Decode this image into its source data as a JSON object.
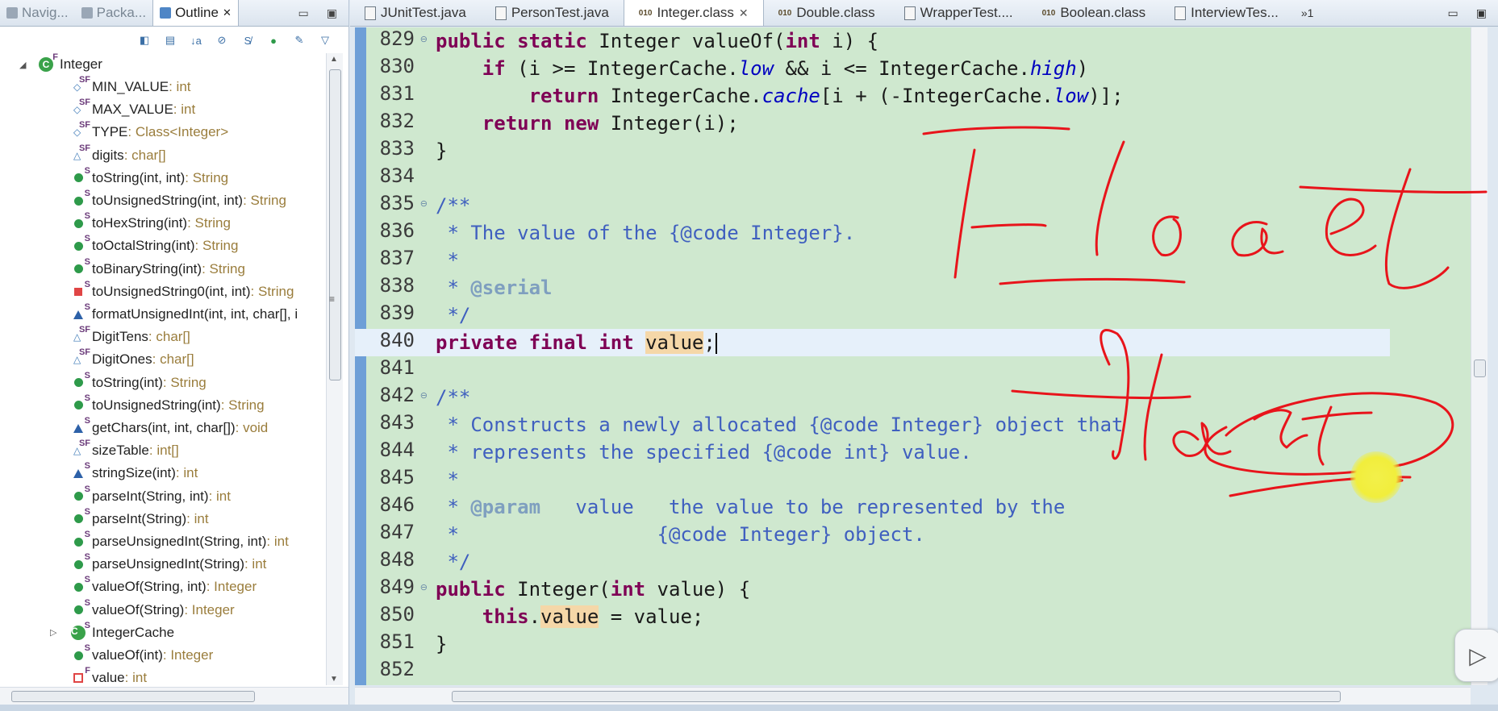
{
  "left_tabs": [
    {
      "label": "Navig...",
      "icon": "navigator-icon"
    },
    {
      "label": "Packa...",
      "icon": "package-icon"
    },
    {
      "label": "Outline",
      "icon": "outline-icon",
      "close": "✕"
    }
  ],
  "window_controls": {
    "minimize": "▭",
    "maximize": "▣"
  },
  "outline_tools": [
    "hide-fields-icon",
    "hide-static-icon",
    "sort-icon",
    "hide-nonpublic-icon",
    "hide-static-members-icon",
    "hide-local-icon",
    "focus-icon",
    "view-menu-icon"
  ],
  "tree_root": {
    "name": "Integer",
    "badge": "F",
    "twisty": "◢"
  },
  "tree_items": [
    {
      "label": "MIN_VALUE",
      "type": " : int",
      "kind": "field-const",
      "mod": "SF"
    },
    {
      "label": "MAX_VALUE",
      "type": " : int",
      "kind": "field-const",
      "mod": "SF"
    },
    {
      "label": "TYPE",
      "type": " : Class<Integer>",
      "kind": "field-const",
      "mod": "SF"
    },
    {
      "label": "digits",
      "type": " : char[]",
      "kind": "field-pkg",
      "mod": "SF"
    },
    {
      "label": "toString(int, int)",
      "type": " : String",
      "kind": "public",
      "mod": "S"
    },
    {
      "label": "toUnsignedString(int, int)",
      "type": " : String",
      "kind": "public",
      "mod": "S"
    },
    {
      "label": "toHexString(int)",
      "type": " : String",
      "kind": "public",
      "mod": "S"
    },
    {
      "label": "toOctalString(int)",
      "type": " : String",
      "kind": "public",
      "mod": "S"
    },
    {
      "label": "toBinaryString(int)",
      "type": " : String",
      "kind": "public",
      "mod": "S"
    },
    {
      "label": "toUnsignedString0(int, int)",
      "type": " : String",
      "kind": "private",
      "mod": "S"
    },
    {
      "label": "formatUnsignedInt(int, int, char[], i",
      "type": "",
      "kind": "package",
      "mod": "S"
    },
    {
      "label": "DigitTens",
      "type": " : char[]",
      "kind": "field-pkg",
      "mod": "SF"
    },
    {
      "label": "DigitOnes",
      "type": " : char[]",
      "kind": "field-pkg",
      "mod": "SF"
    },
    {
      "label": "toString(int)",
      "type": " : String",
      "kind": "public",
      "mod": "S"
    },
    {
      "label": "toUnsignedString(int)",
      "type": " : String",
      "kind": "public",
      "mod": "S"
    },
    {
      "label": "getChars(int, int, char[])",
      "type": " : void",
      "kind": "package",
      "mod": "S"
    },
    {
      "label": "sizeTable",
      "type": " : int[]",
      "kind": "field-pkg",
      "mod": "SF"
    },
    {
      "label": "stringSize(int)",
      "type": " : int",
      "kind": "package",
      "mod": "S"
    },
    {
      "label": "parseInt(String, int)",
      "type": " : int",
      "kind": "public",
      "mod": "S"
    },
    {
      "label": "parseInt(String)",
      "type": " : int",
      "kind": "public",
      "mod": "S"
    },
    {
      "label": "parseUnsignedInt(String, int)",
      "type": " : int",
      "kind": "public",
      "mod": "S"
    },
    {
      "label": "parseUnsignedInt(String)",
      "type": " : int",
      "kind": "public",
      "mod": "S"
    },
    {
      "label": "valueOf(String, int)",
      "type": " : Integer",
      "kind": "public",
      "mod": "S"
    },
    {
      "label": "valueOf(String)",
      "type": " : Integer",
      "kind": "public",
      "mod": "S"
    },
    {
      "label": "IntegerCache",
      "type": "",
      "kind": "class",
      "mod": "S"
    },
    {
      "label": "valueOf(int)",
      "type": " : Integer",
      "kind": "public",
      "mod": "S"
    },
    {
      "label": "value",
      "type": " : int",
      "kind": "field-private",
      "mod": "F"
    }
  ],
  "editor_tabs": [
    {
      "label": "JUnitTest.java",
      "kind": "java"
    },
    {
      "label": "PersonTest.java",
      "kind": "java"
    },
    {
      "label": "Integer.class",
      "kind": "class",
      "active": true,
      "close": "✕"
    },
    {
      "label": "Double.class",
      "kind": "class"
    },
    {
      "label": "WrapperTest....",
      "kind": "java"
    },
    {
      "label": "Boolean.class",
      "kind": "class"
    },
    {
      "label": "InterviewTes...",
      "kind": "java"
    }
  ],
  "more_tabs": "»1",
  "line_numbers": [
    "829",
    "830",
    "831",
    "832",
    "833",
    "834",
    "835",
    "836",
    "837",
    "838",
    "839",
    "840",
    "841",
    "842",
    "843",
    "844",
    "845",
    "846",
    "847",
    "848",
    "849",
    "850",
    "851",
    "852"
  ],
  "fold_lines": [
    "829",
    "835",
    "842",
    "849"
  ],
  "code_lines": [
    [
      {
        "t": "public static ",
        "c": "kw"
      },
      {
        "t": "Integer valueOf(",
        "c": ""
      },
      {
        "t": "int",
        "c": "kw"
      },
      {
        "t": " i) {",
        "c": ""
      }
    ],
    [
      {
        "t": "    ",
        "c": ""
      },
      {
        "t": "if",
        "c": "kw"
      },
      {
        "t": " (i >= IntegerCache.",
        "c": ""
      },
      {
        "t": "low",
        "c": "st"
      },
      {
        "t": " && i <= IntegerCache.",
        "c": ""
      },
      {
        "t": "high",
        "c": "st"
      },
      {
        "t": ")",
        "c": ""
      }
    ],
    [
      {
        "t": "        ",
        "c": ""
      },
      {
        "t": "return",
        "c": "kw"
      },
      {
        "t": " IntegerCache.",
        "c": ""
      },
      {
        "t": "cache",
        "c": "st"
      },
      {
        "t": "[i + (-IntegerCache.",
        "c": ""
      },
      {
        "t": "low",
        "c": "st"
      },
      {
        "t": ")];",
        "c": ""
      }
    ],
    [
      {
        "t": "    ",
        "c": ""
      },
      {
        "t": "return new",
        "c": "kw"
      },
      {
        "t": " Integer(i);",
        "c": ""
      }
    ],
    [
      {
        "t": "}",
        "c": ""
      }
    ],
    [],
    [
      {
        "t": "/**",
        "c": "cm"
      }
    ],
    [
      {
        "t": " * The value of the {@code Integer}.",
        "c": "cm"
      }
    ],
    [
      {
        "t": " *",
        "c": "cm"
      }
    ],
    [
      {
        "t": " * ",
        "c": "cm"
      },
      {
        "t": "@serial",
        "c": "tag"
      }
    ],
    [
      {
        "t": " */",
        "c": "cm"
      }
    ],
    [
      {
        "t": "private final int ",
        "c": "kw"
      },
      {
        "t": "value",
        "c": "hl"
      },
      {
        "t": ";",
        "c": ""
      }
    ],
    [],
    [
      {
        "t": "/**",
        "c": "cm"
      }
    ],
    [
      {
        "t": " * Constructs a newly allocated {@code Integer} object that",
        "c": "cm"
      }
    ],
    [
      {
        "t": " * represents the specified {@code int} value.",
        "c": "cm"
      }
    ],
    [
      {
        "t": " *",
        "c": "cm"
      }
    ],
    [
      {
        "t": " * ",
        "c": "cm"
      },
      {
        "t": "@param",
        "c": "tag"
      },
      {
        "t": "   value   the value to be represented by the",
        "c": "cm"
      }
    ],
    [
      {
        "t": " *                 {@code Integer} object.",
        "c": "cm"
      }
    ],
    [
      {
        "t": " */",
        "c": "cm"
      }
    ],
    [
      {
        "t": "public ",
        "c": "kw"
      },
      {
        "t": "Integer(",
        "c": ""
      },
      {
        "t": "int",
        "c": "kw"
      },
      {
        "t": " value) {",
        "c": ""
      }
    ],
    [
      {
        "t": "    ",
        "c": ""
      },
      {
        "t": "this",
        "c": "kw"
      },
      {
        "t": ".",
        "c": ""
      },
      {
        "t": "value",
        "c": "hl"
      },
      {
        "t": " = value;",
        "c": ""
      }
    ],
    [
      {
        "t": "}",
        "c": ""
      }
    ],
    []
  ],
  "colors": {
    "editor_bg": "#cfe8cf",
    "ink": "#e8141b",
    "keyword": "#7f0055",
    "comment": "#3f5fbf"
  }
}
